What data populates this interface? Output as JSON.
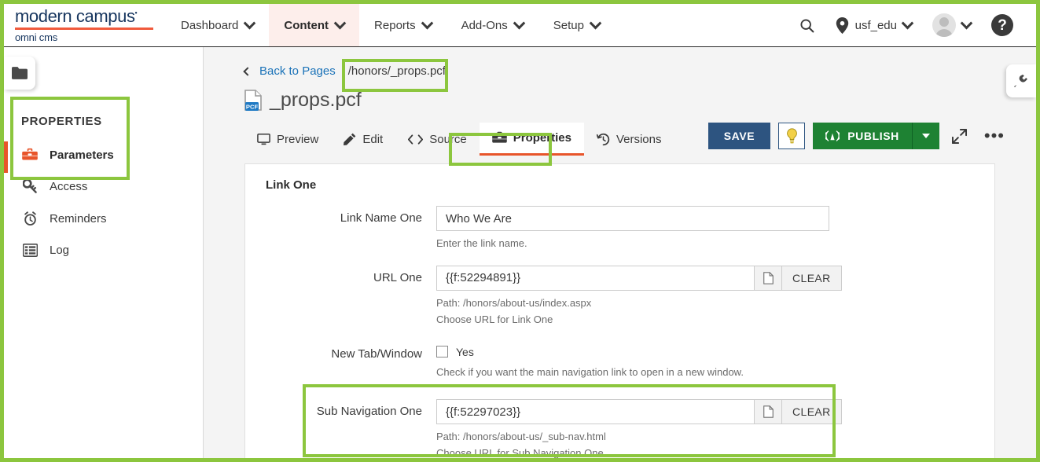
{
  "brand": {
    "logo_main": "modern campus",
    "logo_tm": "•",
    "logo_sub": "omni cms",
    "accent_orange": "#f05a3c",
    "navy": "#16355e",
    "annotation_green": "#8cc63e"
  },
  "topnav": {
    "items": [
      {
        "label": "Dashboard",
        "icon": "chevron-down-icon",
        "active": false
      },
      {
        "label": "Content",
        "icon": "chevron-down-icon",
        "active": true
      },
      {
        "label": "Reports",
        "icon": "chevron-down-icon",
        "active": false
      },
      {
        "label": "Add-Ons",
        "icon": "chevron-down-icon",
        "active": false
      },
      {
        "label": "Setup",
        "icon": "chevron-down-icon",
        "active": false
      }
    ],
    "search_icon": "search-icon",
    "site_pin_icon": "location-pin-icon",
    "site_label": "usf_edu",
    "avatar_icon": "avatar-icon",
    "help_label": "?"
  },
  "sidebar": {
    "folder_icon": "folder-icon",
    "heading": "PROPERTIES",
    "items": [
      {
        "label": "Parameters",
        "icon": "toolbox-icon",
        "active": true
      },
      {
        "label": "Access",
        "icon": "key-icon",
        "active": false
      },
      {
        "label": "Reminders",
        "icon": "alarm-clock-icon",
        "active": false
      },
      {
        "label": "Log",
        "icon": "log-list-icon",
        "active": false
      }
    ]
  },
  "breadcrumb": {
    "back_label": "Back to Pages",
    "path": "/honors/_props.pcf"
  },
  "page": {
    "file_icon_label": "PCF",
    "title": "_props.pcf"
  },
  "tabs": [
    {
      "label": "Preview",
      "icon": "monitor-icon",
      "active": false
    },
    {
      "label": "Edit",
      "icon": "pencil-icon",
      "active": false
    },
    {
      "label": "Source",
      "icon": "code-brackets-icon",
      "active": false
    },
    {
      "label": "Properties",
      "icon": "toolbox-icon",
      "active": true
    },
    {
      "label": "Versions",
      "icon": "history-clock-icon",
      "active": false
    }
  ],
  "actions": {
    "save_label": "SAVE",
    "bulb_icon": "lightbulb-icon",
    "publish_label": "PUBLISH",
    "publish_icon": "broadcast-icon",
    "publish_caret_icon": "caret-down-icon",
    "expand_icon": "expand-arrows-icon",
    "more_icon": "ellipsis-icon",
    "save_color": "#2d5480",
    "publish_color": "#1e8233"
  },
  "gadget_panel": {
    "icon": "plug-icon"
  },
  "form": {
    "section_title": "Link One",
    "fields": [
      {
        "label": "Link Name One",
        "type": "text",
        "value": "Who We Are",
        "help": "Enter the link name.",
        "help2": ""
      },
      {
        "label": "URL One",
        "type": "url",
        "value": "{{f:52294891}}",
        "file_icon": "document-icon",
        "clear_label": "CLEAR",
        "help": "Path: /honors/about-us/index.aspx",
        "help2": "Choose URL for Link One"
      },
      {
        "label": "New Tab/Window",
        "type": "checkbox",
        "value": "Yes",
        "checked": false,
        "help": "Check if you want the main navigation link to open in a new window.",
        "help2": ""
      },
      {
        "label": "Sub Navigation One",
        "type": "url",
        "value": "{{f:52297023}}",
        "file_icon": "document-icon",
        "clear_label": "CLEAR",
        "help": "Path: /honors/about-us/_sub-nav.html",
        "help2": "Choose URL for Sub Navigation One"
      }
    ]
  }
}
